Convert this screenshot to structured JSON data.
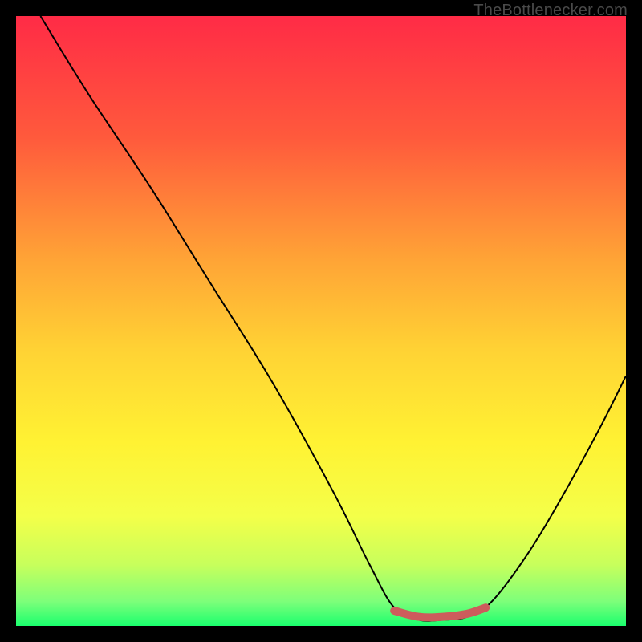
{
  "watermark": "TheBottlenecker.com",
  "chart_data": {
    "type": "line",
    "title": "",
    "xlabel": "",
    "ylabel": "",
    "xlim": [
      0,
      100
    ],
    "ylim": [
      0,
      100
    ],
    "gradient_stops": [
      {
        "offset": 0.0,
        "color": "#ff2b46"
      },
      {
        "offset": 0.2,
        "color": "#ff5a3c"
      },
      {
        "offset": 0.4,
        "color": "#ffa436"
      },
      {
        "offset": 0.55,
        "color": "#ffd334"
      },
      {
        "offset": 0.7,
        "color": "#fff233"
      },
      {
        "offset": 0.82,
        "color": "#f4ff49"
      },
      {
        "offset": 0.9,
        "color": "#c7ff5c"
      },
      {
        "offset": 0.96,
        "color": "#7dff7a"
      },
      {
        "offset": 1.0,
        "color": "#1aff6e"
      }
    ],
    "series": [
      {
        "name": "curve",
        "stroke": "#000000",
        "stroke_width": 2,
        "points": [
          {
            "x": 4,
            "y": 100
          },
          {
            "x": 12,
            "y": 87
          },
          {
            "x": 22,
            "y": 72
          },
          {
            "x": 32,
            "y": 56
          },
          {
            "x": 42,
            "y": 40
          },
          {
            "x": 52,
            "y": 22
          },
          {
            "x": 58,
            "y": 10
          },
          {
            "x": 62,
            "y": 3
          },
          {
            "x": 66,
            "y": 1
          },
          {
            "x": 70,
            "y": 1
          },
          {
            "x": 74,
            "y": 1.5
          },
          {
            "x": 78,
            "y": 4
          },
          {
            "x": 84,
            "y": 12
          },
          {
            "x": 90,
            "y": 22
          },
          {
            "x": 96,
            "y": 33
          },
          {
            "x": 100,
            "y": 41
          }
        ]
      },
      {
        "name": "highlight",
        "stroke": "#cd5c5c",
        "stroke_width": 10,
        "linecap": "round",
        "points": [
          {
            "x": 62,
            "y": 2.5
          },
          {
            "x": 66,
            "y": 1.5
          },
          {
            "x": 70,
            "y": 1.5
          },
          {
            "x": 74,
            "y": 2.0
          },
          {
            "x": 77,
            "y": 3.0
          }
        ]
      }
    ]
  }
}
